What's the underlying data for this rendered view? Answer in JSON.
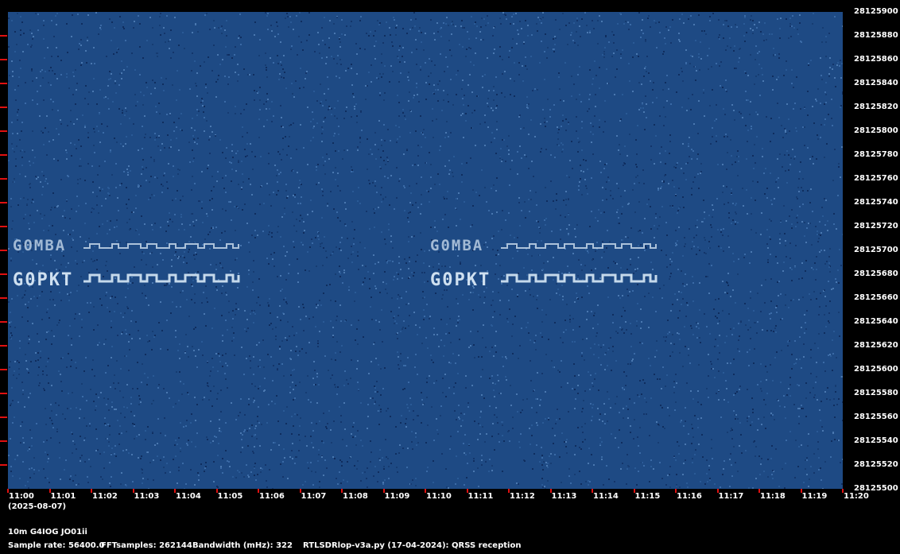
{
  "chart_data": {
    "type": "heatmap",
    "ylabel_ticks": [
      "28125900",
      "28125880",
      "28125860",
      "28125840",
      "28125820",
      "28125800",
      "28125780",
      "28125760",
      "28125740",
      "28125720",
      "28125700",
      "28125680",
      "28125660",
      "28125640",
      "28125620",
      "28125600",
      "28125580",
      "28125560",
      "28125540",
      "28125520",
      "28125500"
    ],
    "xlabel_ticks": [
      "11:00",
      "11:01",
      "11:02",
      "11:03",
      "11:04",
      "11:05",
      "11:06",
      "11:07",
      "11:08",
      "11:09",
      "11:10",
      "11:11",
      "11:12",
      "11:13",
      "11:14",
      "11:15",
      "11:16",
      "11:17",
      "11:18",
      "11:19",
      "11:20"
    ],
    "ylim": [
      28125500,
      28125900
    ],
    "signals": [
      {
        "label": "G0MBA",
        "start": "11:00",
        "end": "11:08",
        "freq": 28125702
      },
      {
        "label": "G0PKT",
        "start": "11:00",
        "end": "11:08",
        "freq": 28125674
      },
      {
        "label": "G0MBA",
        "start": "11:10",
        "end": "11:18",
        "freq": 28125702
      },
      {
        "label": "G0PKT",
        "start": "11:10",
        "end": "11:18",
        "freq": 28125674
      }
    ],
    "colors": {
      "background": "#1e4a84",
      "signal": "#cfe0f0",
      "ticks": "#e01010"
    }
  },
  "info": {
    "date": "(2025-08-07)",
    "station": "10m G4IOG JO01ii",
    "sample_rate": "Sample rate: 56400.0",
    "fft": "FFTsamples: 262144",
    "bandwidth": "Bandwidth (mHz): 322",
    "software": "RTLSDRlop-v3a.py (17-04-2024): QRSS reception"
  }
}
